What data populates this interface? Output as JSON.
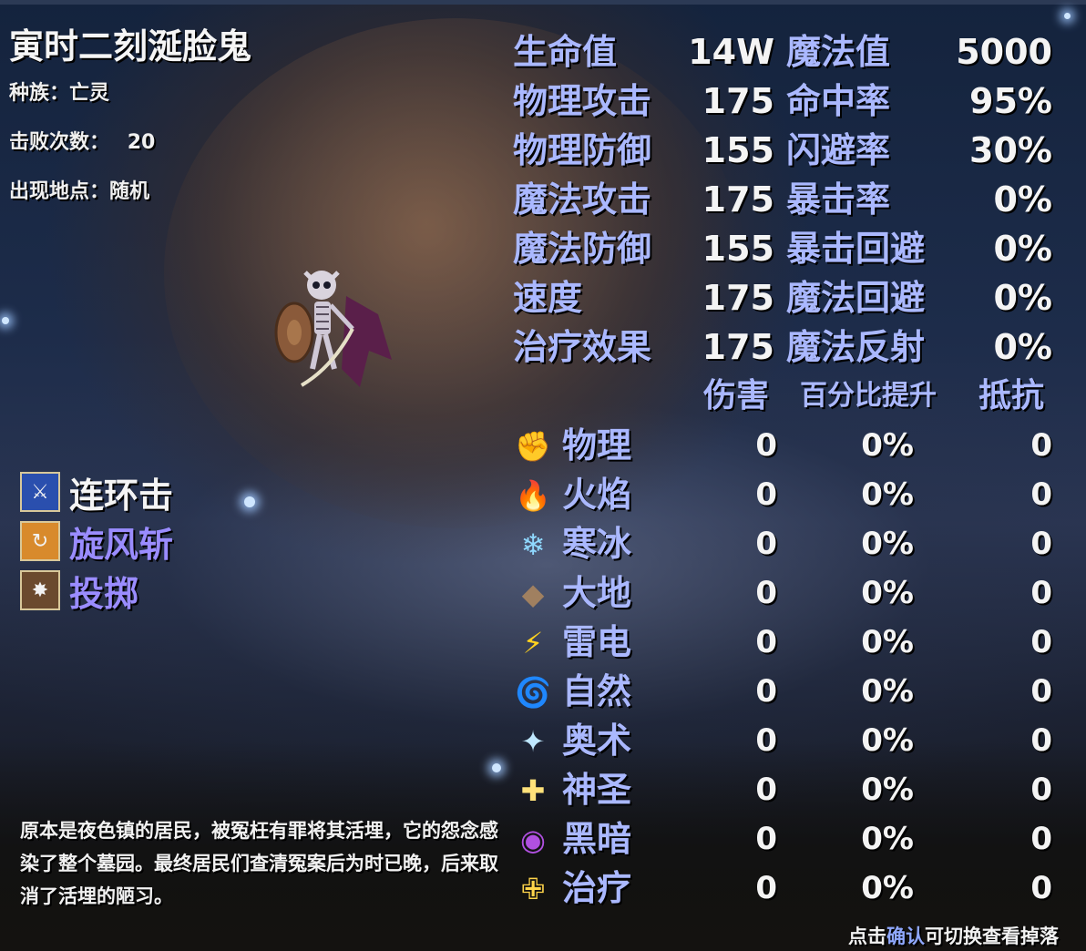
{
  "monster": {
    "name": "寅时二刻涎脸鬼",
    "race_line": "种族：亡灵",
    "defeat_label": "击败次数：",
    "defeat_count": "20",
    "location_line": "出现地点：随机"
  },
  "skills": [
    {
      "label": "连环击",
      "icon": "chain-strike-icon",
      "color": "#f4f4f4",
      "icon_bg": "#2a4fae"
    },
    {
      "label": "旋风斩",
      "icon": "whirlwind-slash-icon",
      "color": "#9a8cff",
      "icon_bg": "#d88a2c"
    },
    {
      "label": "投掷",
      "icon": "throw-icon",
      "color": "#9a8cff",
      "icon_bg": "#6b4a2e"
    }
  ],
  "stats": [
    {
      "label": "生命值",
      "value": "14W",
      "label2": "魔法值",
      "value2": "5000"
    },
    {
      "label": "物理攻击",
      "value": "175",
      "label2": "命中率",
      "value2": "95%"
    },
    {
      "label": "物理防御",
      "value": "155",
      "label2": "闪避率",
      "value2": "30%"
    },
    {
      "label": "魔法攻击",
      "value": "175",
      "label2": "暴击率",
      "value2": "0%"
    },
    {
      "label": "魔法防御",
      "value": "155",
      "label2": "暴击回避",
      "value2": "0%"
    },
    {
      "label": "速度",
      "value": "175",
      "label2": "魔法回避",
      "value2": "0%"
    },
    {
      "label": "治疗效果",
      "value": "175",
      "label2": "魔法反射",
      "value2": "0%"
    }
  ],
  "element_headers": {
    "damage": "伤害",
    "percent": "百分比提升",
    "resist": "抵抗"
  },
  "elements": [
    {
      "label": "物理",
      "icon": "fist-icon",
      "glyph": "✊",
      "damage": "0",
      "percent": "0%",
      "resist": "0"
    },
    {
      "label": "火焰",
      "icon": "fire-icon",
      "glyph": "🔥",
      "damage": "0",
      "percent": "0%",
      "resist": "0"
    },
    {
      "label": "寒冰",
      "icon": "snowflake-icon",
      "glyph": "❄",
      "damage": "0",
      "percent": "0%",
      "resist": "0"
    },
    {
      "label": "大地",
      "icon": "rock-icon",
      "glyph": "◆",
      "damage": "0",
      "percent": "0%",
      "resist": "0"
    },
    {
      "label": "雷电",
      "icon": "lightning-icon",
      "glyph": "⚡",
      "damage": "0",
      "percent": "0%",
      "resist": "0"
    },
    {
      "label": "自然",
      "icon": "leaf-swirl-icon",
      "glyph": "🌀",
      "damage": "0",
      "percent": "0%",
      "resist": "0"
    },
    {
      "label": "奥术",
      "icon": "arcane-crystal-icon",
      "glyph": "✦",
      "damage": "0",
      "percent": "0%",
      "resist": "0"
    },
    {
      "label": "神圣",
      "icon": "holy-cross-icon",
      "glyph": "✚",
      "damage": "0",
      "percent": "0%",
      "resist": "0"
    },
    {
      "label": "黑暗",
      "icon": "dark-vortex-icon",
      "glyph": "◉",
      "damage": "0",
      "percent": "0%",
      "resist": "0"
    },
    {
      "label": "治疗",
      "icon": "heal-cross-icon",
      "glyph": "✙",
      "damage": "0",
      "percent": "0%",
      "resist": "0"
    }
  ],
  "description": "原本是夜色镇的居民，被冤枉有罪将其活埋，它的怨念感染了整个墓园。最终居民们查清冤案后为时已晚，后来取消了活埋的陋习。",
  "hint": {
    "prefix": "点击",
    "accent": "确认",
    "suffix": "可切换查看掉落"
  },
  "colors": {
    "stat_label": "#aab8ff",
    "value": "#f4f4f4",
    "accent": "#8fa8ff"
  }
}
